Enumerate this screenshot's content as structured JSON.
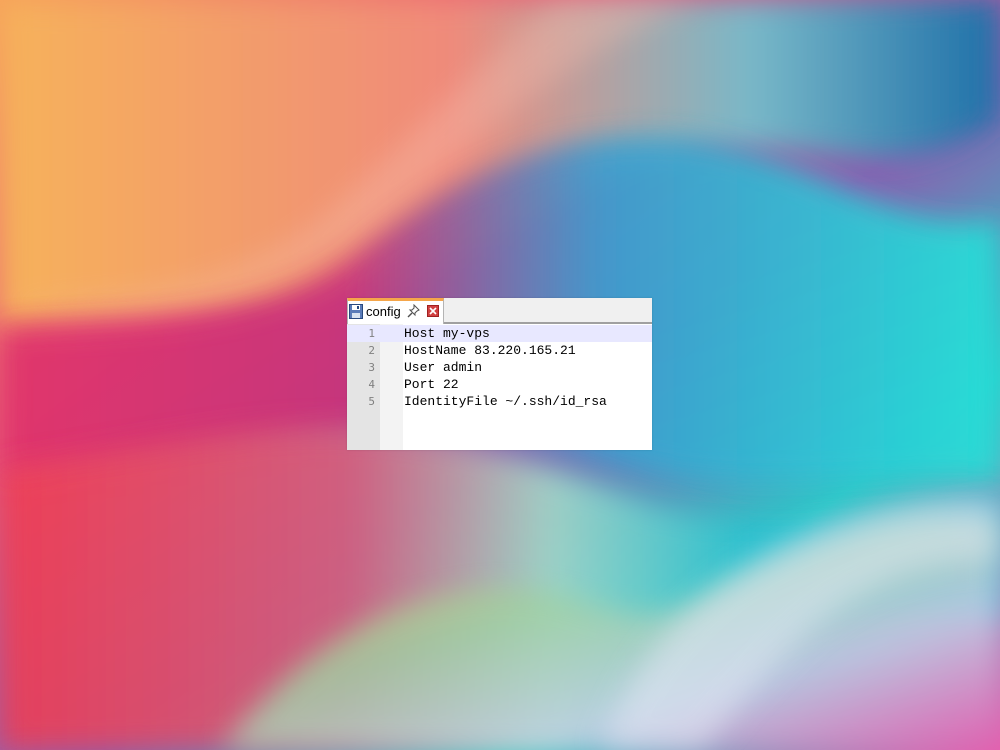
{
  "editor": {
    "tab": {
      "title": "config",
      "icons": [
        "save-icon",
        "pin-icon",
        "close-icon"
      ]
    },
    "lines": [
      {
        "number": "1",
        "text": "Host my-vps"
      },
      {
        "number": "2",
        "text": "HostName 83.220.165.21"
      },
      {
        "number": "3",
        "text": "User admin"
      },
      {
        "number": "4",
        "text": "Port 22"
      },
      {
        "number": "5",
        "text": "IdentityFile ~/.ssh/id_rsa"
      }
    ],
    "current_line": 1
  },
  "colors": {
    "tab_accent": "#f5a64a",
    "close_red": "#d04040",
    "current_line_highlight": "#e8e8ff"
  }
}
